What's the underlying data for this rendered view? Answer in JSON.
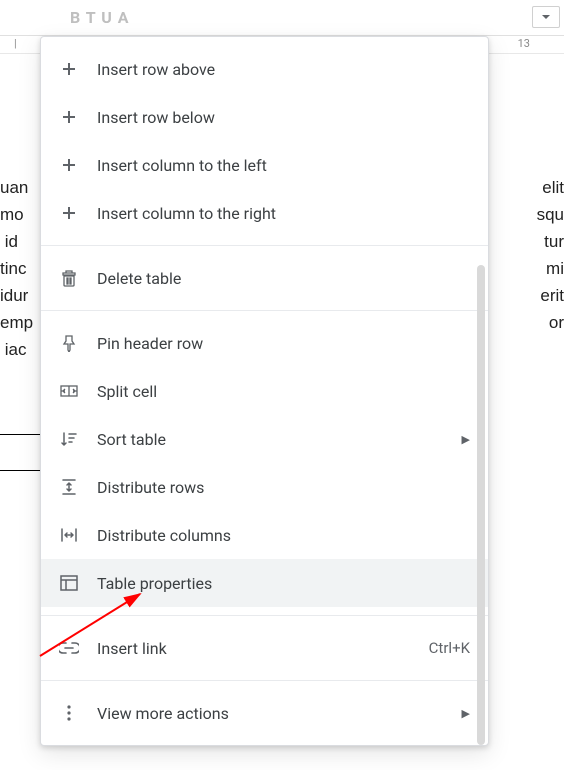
{
  "ruler": {
    "marker": "13"
  },
  "toolbar_faded": "B  T  U  A",
  "doc_text": {
    "left": "uan\nmo\n id \ntinc\nidur\nemp\n iac",
    "right": "elit\nsqu\ntur\nmi\nerit\n or"
  },
  "menu": {
    "insert_row_above": "Insert row above",
    "insert_row_below": "Insert row below",
    "insert_col_left": "Insert column to the left",
    "insert_col_right": "Insert column to the right",
    "delete_table": "Delete table",
    "pin_header": "Pin header row",
    "split_cell": "Split cell",
    "sort_table": "Sort table",
    "distribute_rows": "Distribute rows",
    "distribute_cols": "Distribute columns",
    "table_props": "Table properties",
    "insert_link": "Insert link",
    "insert_link_shortcut": "Ctrl+K",
    "view_more": "View more actions"
  }
}
